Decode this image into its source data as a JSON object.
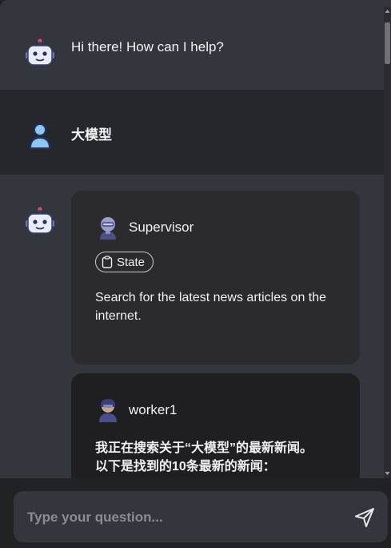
{
  "conversation": {
    "bot_greeting": "Hi there! How can I help?",
    "user_message": "大模型",
    "supervisor": {
      "name": "Supervisor",
      "state_label": "State",
      "text": "Search for the latest news articles on the internet."
    },
    "worker": {
      "name": "worker1",
      "text_line1": "我正在搜索关于“大模型”的最新新闻。",
      "text_line2": "以下是找到的10条最新的新闻："
    }
  },
  "composer": {
    "placeholder": "Type your question..."
  },
  "icons": {
    "bot_avatar": "robot-icon",
    "user_avatar": "user-icon",
    "supervisor_avatar": "robot-agent-avatar",
    "worker_avatar": "worker-agent-avatar",
    "state": "clipboard-icon",
    "send": "send-icon"
  },
  "colors": {
    "bot_row": "#33363d",
    "user_row": "#25272c",
    "supervisor_card": "#2b2b2d",
    "worker_card": "#1f1f21",
    "page": "#212226"
  }
}
